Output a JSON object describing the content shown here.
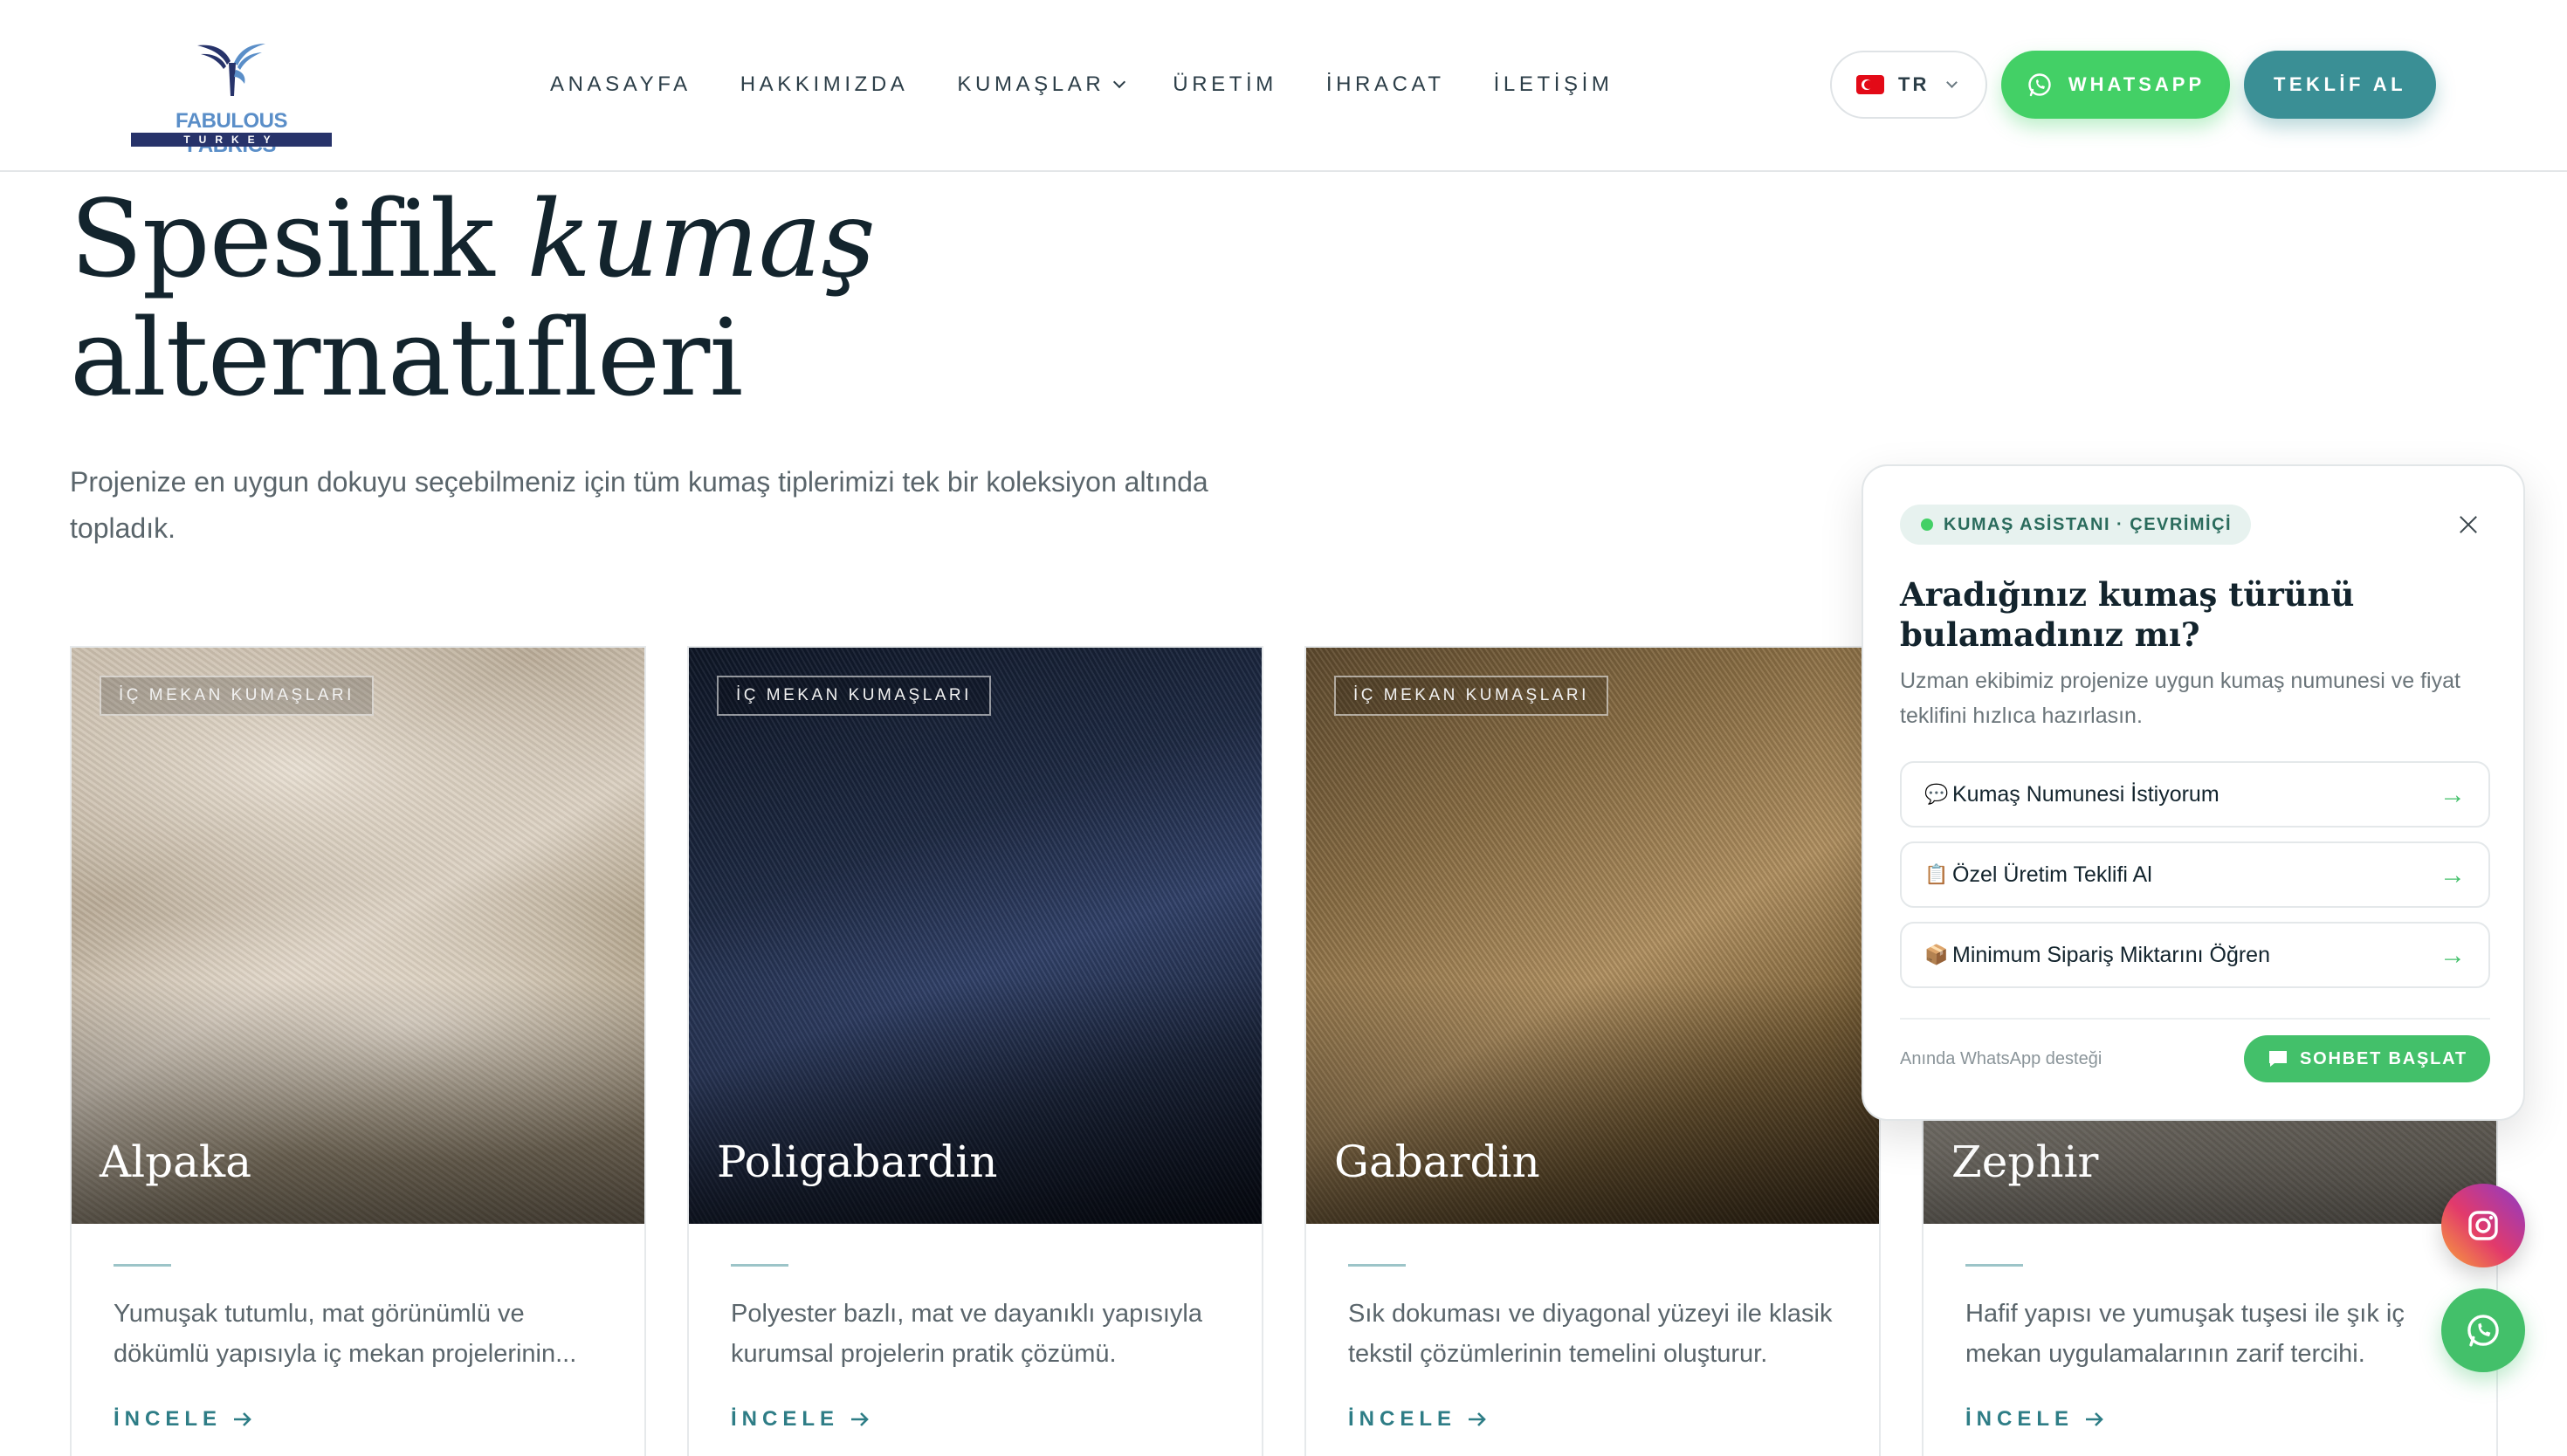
{
  "brand": {
    "name": "FABULOUS FABRICS",
    "sub": "TURKEY",
    "accent": "#3a8f95",
    "whatsapp_green": "#43d066"
  },
  "nav": {
    "items": [
      {
        "label": "ANASAYFA"
      },
      {
        "label": "HAKKIMIZDA"
      },
      {
        "label": "KUMAŞLAR"
      },
      {
        "label": "ÜRETİM"
      },
      {
        "label": "İHRACAT"
      },
      {
        "label": "İLETİŞİM"
      }
    ],
    "language": "TR",
    "whatsapp_label": "WHATSAPP",
    "quote_label": "TEKLİF AL"
  },
  "hero": {
    "title_plain": "Spesifik ",
    "title_italic": "kumaş",
    "title_line2": "alternatifleri",
    "subtitle": "Projenize en uygun dokuyu seçebilmeniz için tüm kumaş tiplerimizi tek bir koleksiyon altında topladık."
  },
  "cards": [
    {
      "tag": "İÇ MEKAN KUMAŞLARI",
      "name": "Alpaka",
      "desc": "Yumuşak tutumlu, mat görünümlü ve dökümlü yapısıyla iç mekan projelerinin...",
      "link": "İNCELE"
    },
    {
      "tag": "İÇ MEKAN KUMAŞLARI",
      "name": "Poligabardin",
      "desc": "Polyester bazlı, mat ve dayanıklı yapısıyla kurumsal projelerin pratik çözümü.",
      "link": "İNCELE"
    },
    {
      "tag": "İÇ MEKAN KUMAŞLARI",
      "name": "Gabardin",
      "desc": "Sık dokuması ve diyagonal yüzeyi ile klasik tekstil çözümlerinin temelini oluşturur.",
      "link": "İNCELE"
    },
    {
      "tag": "",
      "name": "Zephir",
      "desc": "Hafif yapısı ve yumuşak tuşesi ile şık iç mekan uygulamalarının zarif tercihi.",
      "link": "İNCELE"
    }
  ],
  "chat": {
    "badge": "KUMAŞ ASİSTANI · ÇEVRİMİÇİ",
    "title": "Aradığınız kumaş türünü bulamadınız mı?",
    "desc": "Uzman ekibimiz projenize uygun kumaş numunesi ve fiyat teklifini hızlıca hazırlasın.",
    "options": [
      {
        "icon": "💬",
        "icon_name": "speech-bubble-icon",
        "label": "Kumaş Numunesi İstiyorum"
      },
      {
        "icon": "📋",
        "icon_name": "clipboard-icon",
        "label": "Özel Üretim Teklifi Al"
      },
      {
        "icon": "📦",
        "icon_name": "package-icon",
        "label": "Minimum Sipariş Miktarını Öğren"
      }
    ],
    "arrow": "→",
    "footer": "Anında WhatsApp desteği",
    "start_label": "SOHBET BAŞLAT"
  }
}
